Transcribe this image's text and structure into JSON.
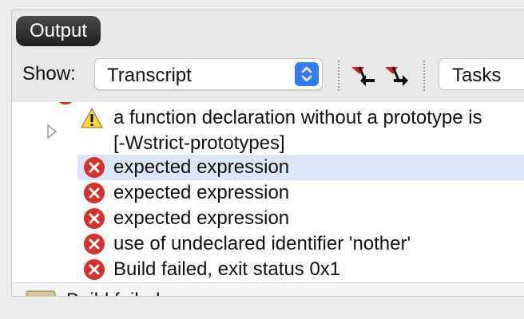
{
  "output_button": {
    "label": "Output"
  },
  "toolbar": {
    "show_label": "Show:",
    "show_select_value": "Transcript",
    "tasks_select_value": "Tasks"
  },
  "messages": {
    "warning_line1": "a function declaration without a prototype is",
    "warning_line2": "[-Wstrict-prototypes]",
    "error1": "expected expression",
    "error2": "expected expression",
    "error3": "expected expression",
    "error4": "use of undeclared identifier 'nother'",
    "error5": "Build failed, exit status 0x1"
  },
  "bottom": {
    "label": "Build failed"
  },
  "colors": {
    "error_red": "#d9302c",
    "warning_yellow": "#f5d33a",
    "selection_blue": "#dbe6fb",
    "accent": "#2f7df6"
  }
}
